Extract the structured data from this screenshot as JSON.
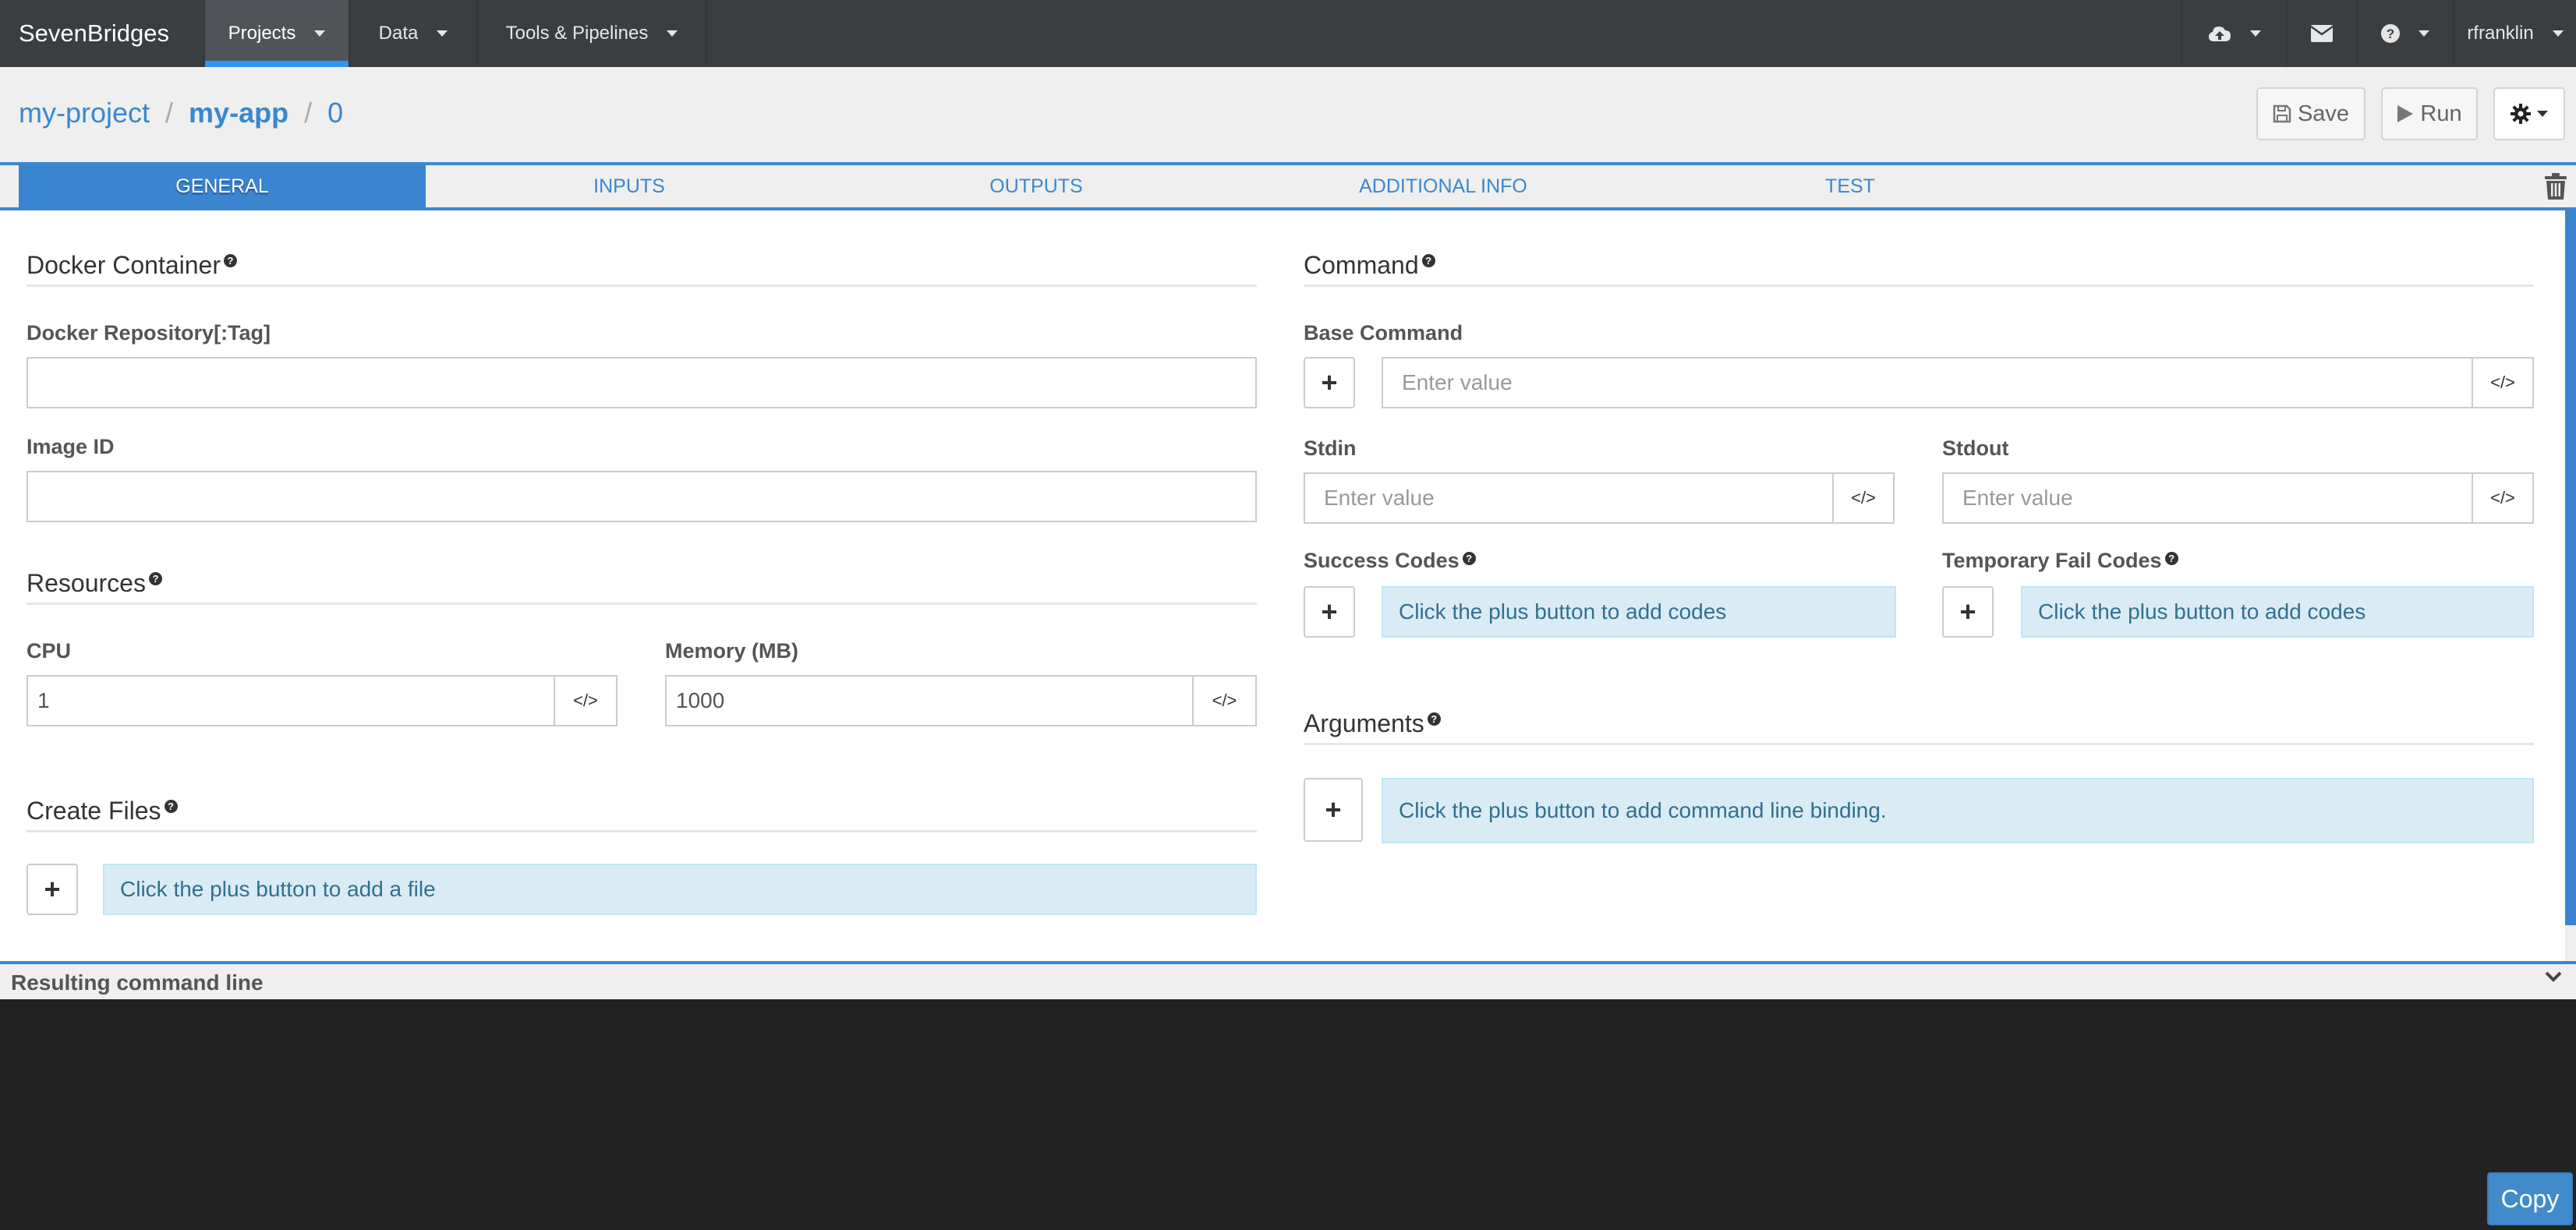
{
  "navbar": {
    "brand": "SevenBridges",
    "items": [
      {
        "label": "Projects",
        "active": true
      },
      {
        "label": "Data",
        "active": false
      },
      {
        "label": "Tools & Pipelines",
        "active": false
      }
    ],
    "right": {
      "upload_icon": "cloud-upload-icon",
      "mail_icon": "envelope-icon",
      "help_icon": "question-circle-icon",
      "user": "rfranklin"
    }
  },
  "breadcrumb": {
    "project": "my-project",
    "app": "my-app",
    "revision": "0",
    "separator": "/"
  },
  "toolbar": {
    "save_label": "Save",
    "run_label": "Run",
    "settings_icon": "gear-icon"
  },
  "tabs": [
    {
      "label": "GENERAL",
      "active": true
    },
    {
      "label": "INPUTS",
      "active": false
    },
    {
      "label": "OUTPUTS",
      "active": false
    },
    {
      "label": "ADDITIONAL INFO",
      "active": false
    },
    {
      "label": "TEST",
      "active": false
    }
  ],
  "left": {
    "docker": {
      "title": "Docker Container",
      "repo_label": "Docker Repository[:Tag]",
      "repo_value": "",
      "image_label": "Image ID",
      "image_value": ""
    },
    "resources": {
      "title": "Resources",
      "cpu_label": "CPU",
      "cpu_value": "1",
      "memory_label": "Memory (MB)",
      "memory_value": "1000"
    },
    "create_files": {
      "title": "Create Files",
      "hint": "Click the plus button to add a file"
    }
  },
  "right": {
    "command": {
      "title": "Command",
      "base_label": "Base Command",
      "base_placeholder": "Enter value",
      "stdin_label": "Stdin",
      "stdin_placeholder": "Enter value",
      "stdout_label": "Stdout",
      "stdout_placeholder": "Enter value",
      "success_label": "Success Codes",
      "success_hint": "Click the plus button to add codes",
      "tempfail_label": "Temporary Fail Codes",
      "tempfail_hint": "Click the plus button to add codes"
    },
    "arguments": {
      "title": "Arguments",
      "hint": "Click the plus button to add command line binding."
    }
  },
  "bottom": {
    "title": "Resulting command line",
    "copy_label": "Copy",
    "command_line": ""
  },
  "colors": {
    "navbar_bg": "#3b3e41",
    "accent": "#3a84d0",
    "link": "#3a87cf",
    "info_bg": "#d9ecf6",
    "info_text": "#31708f",
    "console_bg": "#222222"
  },
  "symbols": {
    "plus": "+",
    "code": "</>",
    "help": "?"
  }
}
